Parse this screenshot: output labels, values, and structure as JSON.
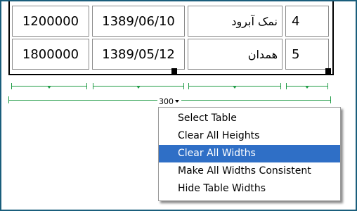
{
  "table": {
    "rows": [
      {
        "amount": "1200000",
        "date": "1389/06/10",
        "city": "نمک آبرود",
        "index": "4"
      },
      {
        "amount": "1800000",
        "date": "1389/05/12",
        "city": "همدان",
        "index": "5"
      }
    ]
  },
  "table_width": {
    "label": "300"
  },
  "context_menu": {
    "items": [
      {
        "label": "Select Table"
      },
      {
        "label": "Clear All Heights"
      },
      {
        "label": "Clear All Widths",
        "highlighted": true
      },
      {
        "label": "Make All Widths Consistent"
      },
      {
        "label": "Hide Table Widths"
      }
    ]
  },
  "colors": {
    "frame_border": "#1a5e7c",
    "width_guides": "#1f9b45",
    "menu_highlight": "#2f6fc6"
  },
  "icons": [
    "resize-handle-icon",
    "width-guide-arrow-icon",
    "dropdown-caret-icon"
  ]
}
